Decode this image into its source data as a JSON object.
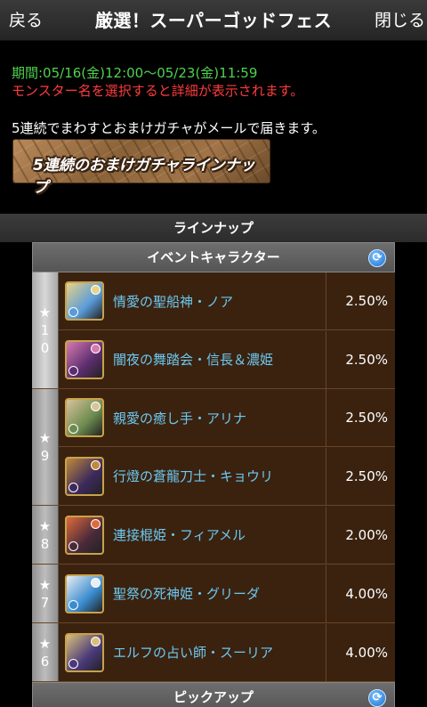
{
  "header": {
    "back_label": "戻る",
    "title": "厳選！スーパーゴッドフェス",
    "close_label": "閉じる"
  },
  "info": {
    "period": "期間:05/16(金)12:00〜05/23(金)11:59",
    "hint": "モンスター名を選択すると詳細が表示されます。",
    "note": "5連続でまわすとおまけガチャがメールで届きます。",
    "banner": "5連続のおまけガチャラインナップ"
  },
  "lineup": {
    "title": "ラインナップ"
  },
  "sections": {
    "event": {
      "title": "イベントキャラクター"
    },
    "pickup": {
      "title": "ピックアップ"
    }
  },
  "groups": [
    {
      "rarity": [
        "★",
        "1",
        "0"
      ],
      "rows": [
        {
          "name": "情愛の聖船神・ノア",
          "rate": "2.50%",
          "colors": [
            "#5a9bd8",
            "#e8d38a"
          ]
        },
        {
          "name": "闇夜の舞踏会・信長＆濃姫",
          "rate": "2.50%",
          "colors": [
            "#5b2d6e",
            "#d77ab0"
          ]
        }
      ]
    },
    {
      "rarity": [
        "★",
        "9"
      ],
      "rows": [
        {
          "name": "親愛の癒し手・アリナ",
          "rate": "2.50%",
          "colors": [
            "#6c8a4e",
            "#d8c39a"
          ]
        },
        {
          "name": "行燈の蒼龍刀士・キョウリ",
          "rate": "2.50%",
          "colors": [
            "#3d2a5c",
            "#c08a3a"
          ]
        }
      ]
    },
    {
      "rarity": [
        "★",
        "8"
      ],
      "rows": [
        {
          "name": "連接棍姫・フィアメル",
          "rate": "2.00%",
          "colors": [
            "#4a2a3a",
            "#e06a3a"
          ]
        }
      ]
    },
    {
      "rarity": [
        "★",
        "7"
      ],
      "rows": [
        {
          "name": "聖祭の死神姫・グリーダ",
          "rate": "4.00%",
          "colors": [
            "#3a8ccf",
            "#e9eef2"
          ]
        }
      ]
    },
    {
      "rarity": [
        "★",
        "6"
      ],
      "rows": [
        {
          "name": "エルフの占い師・スーリア",
          "rate": "4.00%",
          "colors": [
            "#4a3a7a",
            "#d9c07a"
          ]
        }
      ]
    }
  ]
}
